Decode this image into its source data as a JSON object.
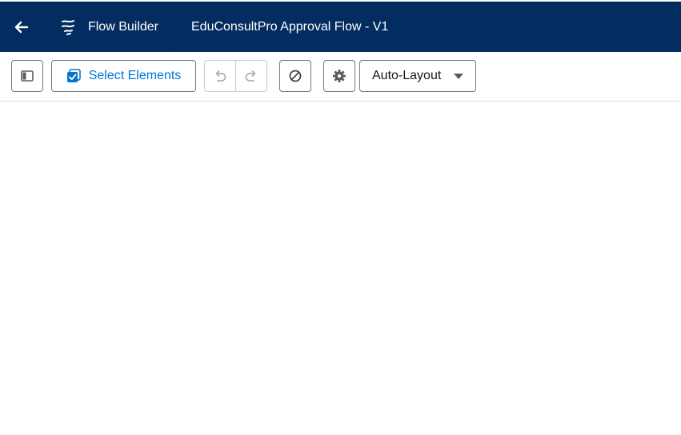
{
  "header": {
    "brand_label": "Flow Builder",
    "flow_title": "EduConsultPro Approval Flow - V1",
    "icons": {
      "back": "arrow-left-icon",
      "brand": "flow-icon"
    }
  },
  "toolbar": {
    "select_elements_label": "Select Elements",
    "layout_mode": "Auto-Layout",
    "icons": {
      "panel": "toggle-panel-icon",
      "select": "select-elements-icon",
      "undo": "undo-icon",
      "redo": "redo-icon",
      "stop": "prohibit-icon",
      "settings": "gear-icon",
      "dropdown": "caret-down-icon"
    }
  },
  "colors": {
    "header_bg": "#032d60",
    "accent": "#0176d3",
    "border": "#747474"
  }
}
